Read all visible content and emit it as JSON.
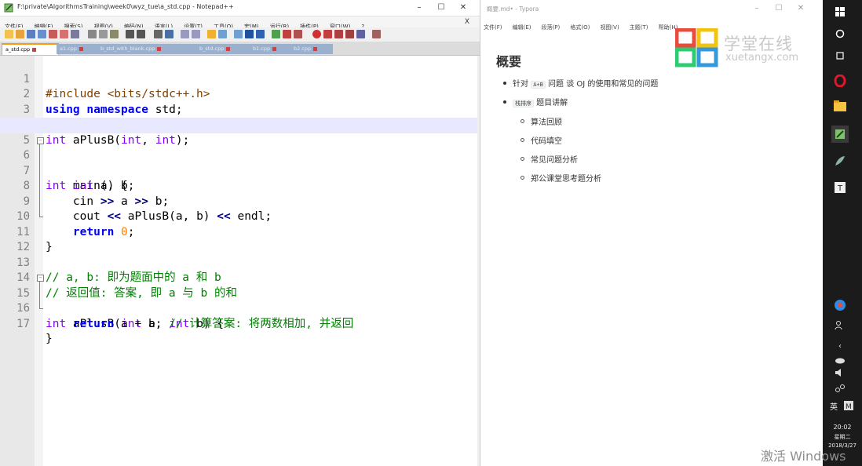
{
  "notepad": {
    "title": "F:\\private\\AlgorithmsTraining\\week0\\wyz_tue\\a_std.cpp - Notepad++",
    "menu": [
      "文件(F)",
      "编辑(E)",
      "搜索(S)",
      "视图(V)",
      "编码(N)",
      "语言(L)",
      "设置(T)",
      "工具(O)",
      "宏(M)",
      "运行(R)",
      "插件(P)",
      "窗口(W)",
      "?"
    ],
    "menu_close": "X",
    "tabs": [
      {
        "label": "a_std.cpp",
        "active": true
      },
      {
        "label": "a1.cpp",
        "active": false
      },
      {
        "label": "b_std_with_blank.cpp",
        "active": false
      },
      {
        "label": "b_std.cpp",
        "active": false
      },
      {
        "label": "b1.cpp",
        "active": false
      },
      {
        "label": "b2.cpp",
        "active": false
      }
    ],
    "lines": [
      {
        "n": "1"
      },
      {
        "n": "2"
      },
      {
        "n": "3"
      },
      {
        "n": "4"
      },
      {
        "n": "5"
      },
      {
        "n": "6"
      },
      {
        "n": "7"
      },
      {
        "n": "8"
      },
      {
        "n": "9"
      },
      {
        "n": "10"
      },
      {
        "n": "11"
      },
      {
        "n": "12"
      },
      {
        "n": "13"
      },
      {
        "n": "14"
      },
      {
        "n": "15"
      },
      {
        "n": "16"
      },
      {
        "n": "17"
      }
    ],
    "code": {
      "l1": "#include <bits/stdc++.h>",
      "l2_kw1": "using",
      "l2_kw2": "namespace",
      "l2_rest": " std;",
      "l4_type": "int",
      "l4_a": " aPlusB(",
      "l4_t1": "int",
      "l4_b": ", ",
      "l4_t2": "int",
      "l4_c": ");",
      "l6_type": "int",
      "l6_rest": " main() {",
      "l7_indent": "    ",
      "l7_type": "int",
      "l7_rest": " a, b;",
      "l8_a": "    cin ",
      "l8_op1": ">>",
      "l8_b": " a ",
      "l8_op2": ">>",
      "l8_c": " b;",
      "l9_a": "    cout ",
      "l9_op1": "<<",
      "l9_b": " aPlusB(a, b) ",
      "l9_op2": "<<",
      "l9_c": " endl;",
      "l10_indent": "    ",
      "l10_kw": "return",
      "l10_sp": " ",
      "l10_num": "0",
      "l10_end": ";",
      "l11": "}",
      "l13": "// a, b: 即为题面中的 a 和 b",
      "l14": "// 返回值: 答案, 即 a 与 b 的和",
      "l15_type": "int",
      "l15_a": " aPlusB(",
      "l15_t1": "int",
      "l15_b": " a, ",
      "l15_t2": "int",
      "l15_c": " b) {",
      "l16_indent": "    ",
      "l16_kw": "return",
      "l16_rest": " a + b; ",
      "l16_cm": "// 计算答案: 将两数相加, 并返回",
      "l17": "}"
    }
  },
  "typora": {
    "title": "概要.md• - Typora",
    "menu": [
      "文件(F)",
      "编辑(E)",
      "段落(P)",
      "格式(O)",
      "视图(V)",
      "主题(T)",
      "帮助(H)"
    ],
    "heading": "概要",
    "items": [
      {
        "pre": "针对 ",
        "code": "A+B",
        "post": " 问题 谈 OJ 的使用和常见的问题"
      },
      {
        "pre": "",
        "code": "栈排序",
        "post": " 题目讲解"
      }
    ],
    "subitems": [
      "算法回顾",
      "代码填空",
      "常见问题分析",
      "郑公课堂思考题分析"
    ],
    "watermark_cn": "学堂在线",
    "watermark_en": "xuetangx.com"
  },
  "taskbar": {
    "ime": "英",
    "time": "20:02",
    "weekday": "星期二",
    "date": "2018/3/27"
  },
  "activate_windows": "激活 Windows"
}
